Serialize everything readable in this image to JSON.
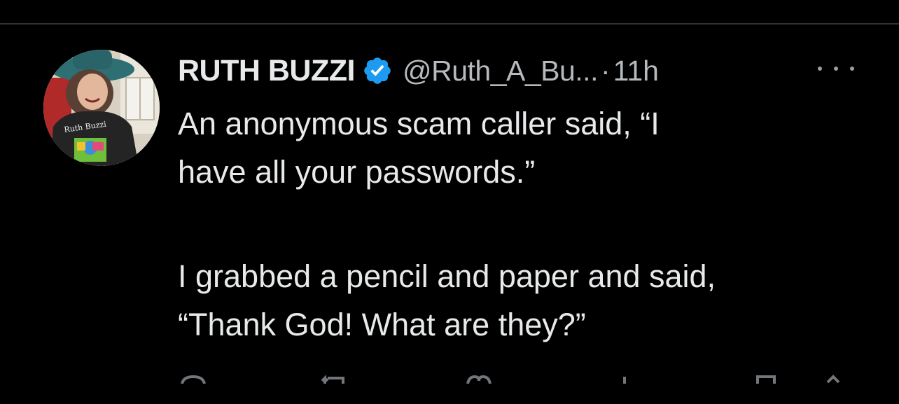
{
  "tweet": {
    "display_name": "RUTH BUZZI",
    "handle": "@Ruth_A_Bu...",
    "separator": "·",
    "timestamp": "11h",
    "verified": true,
    "verified_color": "#1d9bf0",
    "lines": [
      "An anonymous scam caller said, “I",
      "have all your passwords.”",
      "I grabbed a pencil and paper and said,",
      "“Thank God!  What are they?”"
    ],
    "avatar": {
      "caption": "Ruth Buzzi"
    },
    "more_icon": "more-horizontal-icon",
    "actions": [
      "reply-icon",
      "retweet-icon",
      "like-icon",
      "views-icon",
      "bookmark-icon",
      "share-icon"
    ]
  },
  "colors": {
    "background": "#000000",
    "text": "#e7e9ea",
    "secondary": "#b6babe",
    "divider": "#2f3336"
  }
}
